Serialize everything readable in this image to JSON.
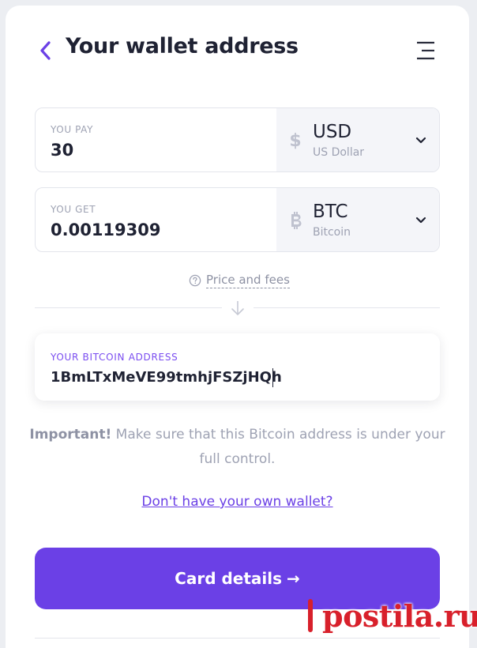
{
  "header": {
    "title": "Your wallet address",
    "back_icon": "chevron-left-icon",
    "menu_icon": "menu-icon"
  },
  "pay": {
    "label": "YOU PAY",
    "value": "30",
    "currency_code": "USD",
    "currency_name": "US Dollar",
    "currency_icon": "dollar-icon"
  },
  "get": {
    "label": "YOU GET",
    "value": "0.00119309",
    "currency_code": "BTC",
    "currency_name": "Bitcoin",
    "currency_icon": "bitcoin-icon"
  },
  "price_fees": {
    "label": "Price and fees",
    "icon": "help-circle-icon"
  },
  "address": {
    "label": "YOUR BITCOIN ADDRESS",
    "value": "1BmLTxMeVE99tmhjFSZjHQh"
  },
  "notice": {
    "strong": "Important!",
    "text": " Make sure that this Bitcoin address is under your full control."
  },
  "wallet_link": {
    "label": "Don't have your own wallet?"
  },
  "cta": {
    "label": "Card details",
    "arrow": "→"
  },
  "watermark": {
    "text": "postila.ru"
  },
  "colors": {
    "accent": "#6b40e6",
    "text": "#1f2233",
    "muted": "#9ea2b3",
    "watermark": "#d8202b"
  }
}
